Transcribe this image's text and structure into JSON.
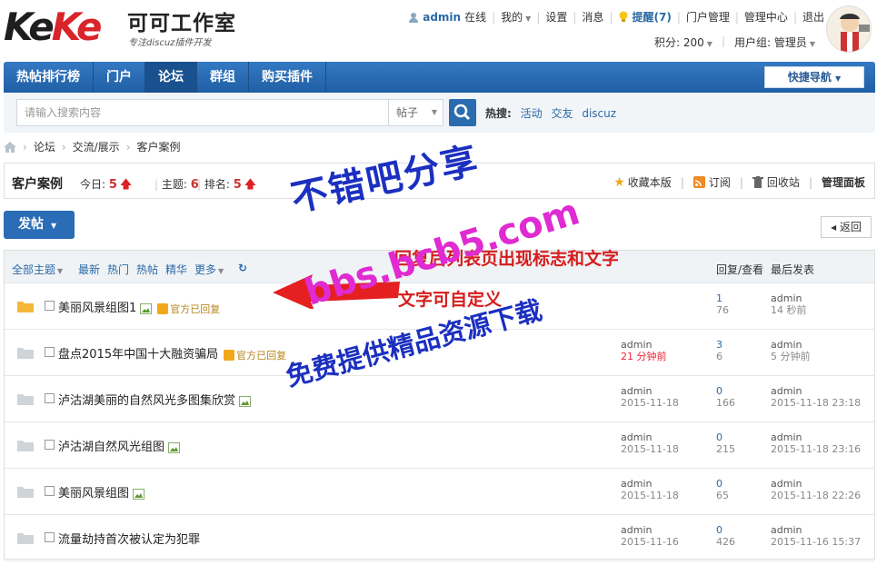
{
  "brand": {
    "logo": "KeKe",
    "name": "可可工作室",
    "slogan": "专注discuz插件开发"
  },
  "topnav": {
    "user": "admin",
    "online": "在线",
    "mine": "我的",
    "settings": "设置",
    "messages": "消息",
    "remind": "提醒(7)",
    "portal_manage": "门户管理",
    "admin_center": "管理中心",
    "logout": "退出",
    "points": "积分: 200",
    "usergroup": "用户组: 管理员"
  },
  "mainnav": {
    "items": [
      "热帖排行榜",
      "门户",
      "论坛",
      "群组",
      "购买插件"
    ],
    "active": 2,
    "quick": "快捷导航"
  },
  "search": {
    "placeholder": "请输入搜索内容",
    "type": "帖子",
    "hot_label": "热搜:",
    "hot": [
      "活动",
      "交友",
      "discuz"
    ]
  },
  "breadcrumb": [
    "论坛",
    "交流/展示",
    "客户案例"
  ],
  "forum": {
    "name": "客户案例",
    "today_label": "今日:",
    "today": "5",
    "topics_label": "主题:",
    "topics": "6",
    "rank_label": "排名:",
    "rank": "5",
    "actions": [
      "收藏本版",
      "订阅",
      "回收站",
      "管理面板"
    ]
  },
  "post_button": "发帖",
  "back_button": "返回",
  "list_header": {
    "filters": [
      "全部主题",
      "最新",
      "热门",
      "热帖",
      "精华",
      "更多"
    ],
    "reply_view": "回复/查看",
    "last_post": "最后发表"
  },
  "threads": [
    {
      "title": "美丽风景组图1",
      "has_img": true,
      "badge": "官方已回复",
      "author": "",
      "time": "",
      "replies": "1",
      "views": "76",
      "last_user": "admin",
      "last_time": "14 秒前",
      "new": true,
      "red": false
    },
    {
      "title": "盘点2015年中国十大融资骗局",
      "has_img": false,
      "badge": "官方已回复",
      "author": "admin",
      "time": "21 分钟前",
      "replies": "3",
      "views": "6",
      "last_user": "admin",
      "last_time": "5 分钟前",
      "new": false,
      "red": true
    },
    {
      "title": "泸沽湖美丽的自然风光多图集欣赏",
      "has_img": true,
      "badge": "",
      "author": "admin",
      "time": "2015-11-18",
      "replies": "0",
      "views": "166",
      "last_user": "admin",
      "last_time": "2015-11-18 23:18",
      "new": false,
      "red": false
    },
    {
      "title": "泸沽湖自然风光组图",
      "has_img": true,
      "badge": "",
      "author": "admin",
      "time": "2015-11-18",
      "replies": "0",
      "views": "215",
      "last_user": "admin",
      "last_time": "2015-11-18 23:16",
      "new": false,
      "red": false
    },
    {
      "title": "美丽风景组图",
      "has_img": true,
      "badge": "",
      "author": "admin",
      "time": "2015-11-18",
      "replies": "0",
      "views": "65",
      "last_user": "admin",
      "last_time": "2015-11-18 22:26",
      "new": false,
      "red": false
    },
    {
      "title": "流量劫持首次被认定为犯罪",
      "has_img": false,
      "badge": "",
      "author": "admin",
      "time": "2015-11-16",
      "replies": "0",
      "views": "426",
      "last_user": "admin",
      "last_time": "2015-11-16 15:37",
      "new": false,
      "red": false
    }
  ],
  "overlay": {
    "text1": "不错吧分享",
    "text2": "回复后列表页出现标志和文字",
    "text3": "文字可自定义",
    "text4": "bbs.bcb5.com",
    "text5": "免费提供精品资源下载"
  },
  "colors": {
    "nav": "#2a6db5",
    "link": "#2b6aa6",
    "badge": "#b8861b",
    "overlay_blue": "#1b2fc0",
    "overlay_red": "#d51d1d",
    "overlay_pink": "#e02ad2"
  }
}
